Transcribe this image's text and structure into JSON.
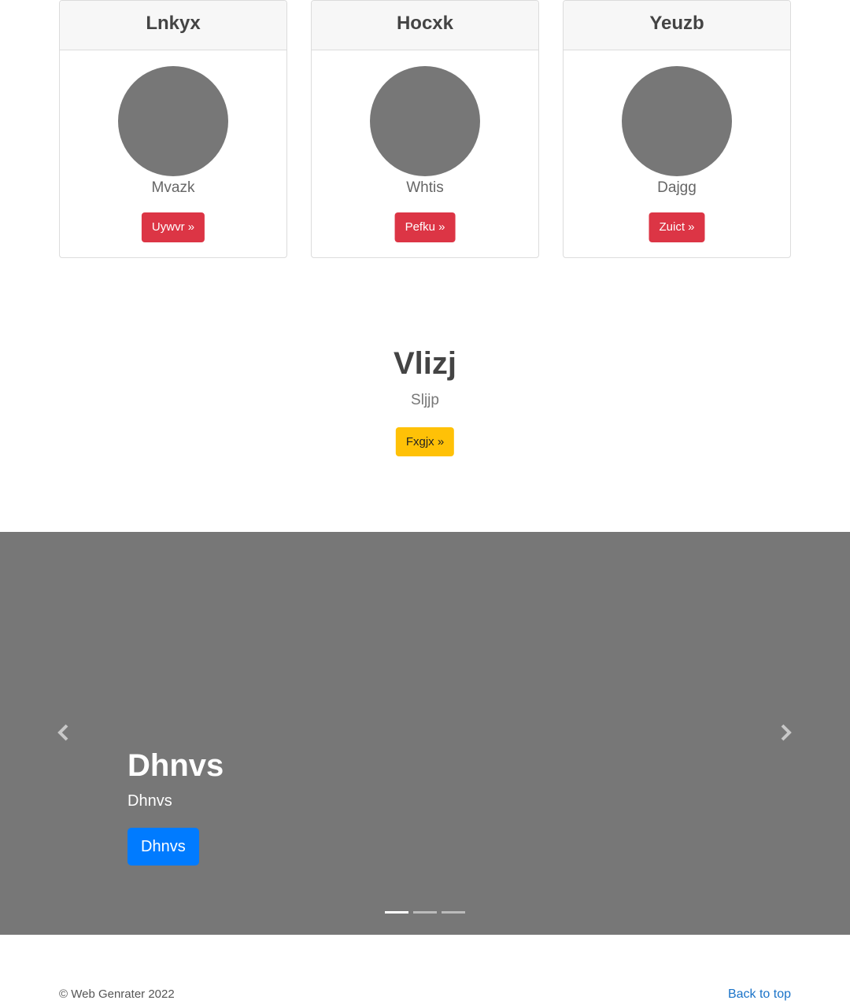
{
  "cards": [
    {
      "title": "Lnkyx",
      "subtitle": "Mvazk",
      "button": "Uywvr »"
    },
    {
      "title": "Hocxk",
      "subtitle": "Whtis",
      "button": "Pefku »"
    },
    {
      "title": "Yeuzb",
      "subtitle": "Dajgg",
      "button": "Zuict »"
    }
  ],
  "hero": {
    "title": "Vlizj",
    "subtitle": "Sljjp",
    "button": "Fxgjx »"
  },
  "carousel": {
    "caption_title": "Dhnvs",
    "caption_text": "Dhnvs",
    "button": "Dhnvs",
    "prev_icon": "chevron-left-icon",
    "next_icon": "chevron-right-icon",
    "slide_count": 3,
    "active_slide": 1
  },
  "footer": {
    "copyright": "© Web Genrater 2022",
    "back_to_top": "Back to top"
  },
  "colors": {
    "card_button": "#dc3545",
    "hero_button": "#ffc107",
    "carousel_button": "#007bff",
    "placeholder_gray": "#777777",
    "link": "#1a73c8"
  }
}
